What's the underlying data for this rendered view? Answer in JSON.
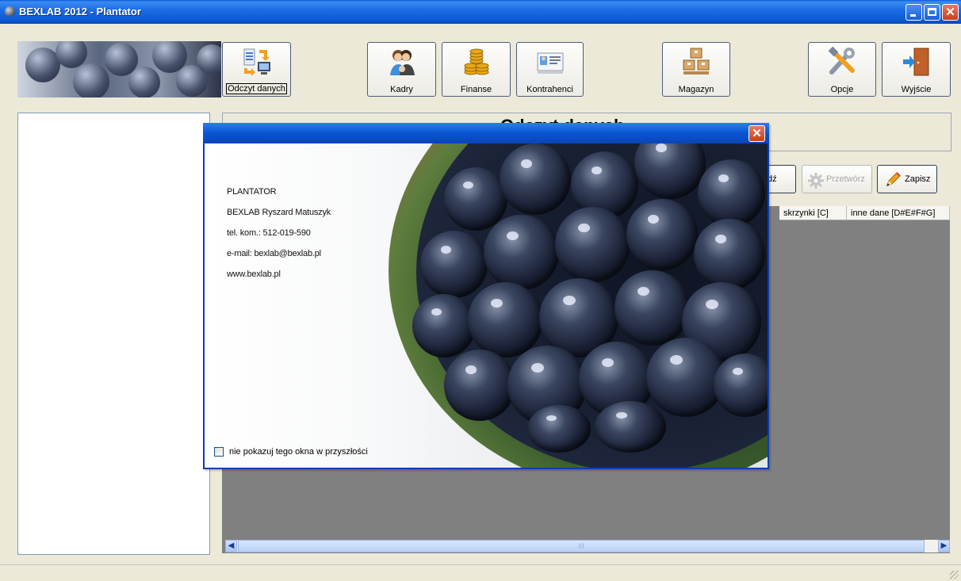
{
  "window": {
    "title": "BEXLAB 2012 - Plantator"
  },
  "toolbar": [
    {
      "id": "odczyt",
      "label": "Odczyt danych",
      "icon": "data-read-icon",
      "selected": true
    },
    {
      "id": "kadry",
      "label": "Kadry",
      "icon": "people-icon"
    },
    {
      "id": "finanse",
      "label": "Finanse",
      "icon": "coins-icon"
    },
    {
      "id": "kontrahenci",
      "label": "Kontrahenci",
      "icon": "id-card-icon"
    },
    {
      "id": "magazyn",
      "label": "Magazyn",
      "icon": "boxes-icon"
    },
    {
      "id": "opcje",
      "label": "Opcje",
      "icon": "tools-icon"
    },
    {
      "id": "wyjscie",
      "label": "Wyjście",
      "icon": "exit-door-icon"
    }
  ],
  "header": {
    "heading_visible": "Odczyt danych"
  },
  "actions": {
    "partial_label": "dź",
    "przetworz": "Przetwórz",
    "zapisz": "Zapisz"
  },
  "grid": {
    "columns": [
      "skrzynki [C]",
      "inne dane [D#E#F#G]"
    ],
    "scroll_marker": "III"
  },
  "dialog": {
    "lines": [
      "PLANTATOR",
      "BEXLAB Ryszard Matuszyk",
      "tel. kom.: 512-019-590",
      "e-mail: bexlab@bexlab.pl",
      "www.bexlab.pl"
    ],
    "checkbox_label": "nie pokazuj tego okna w przyszłości",
    "checkbox_checked": false
  },
  "colors": {
    "titlebar": "#0a56cf",
    "accent": "#0a3fb3",
    "close": "#c6401d"
  }
}
